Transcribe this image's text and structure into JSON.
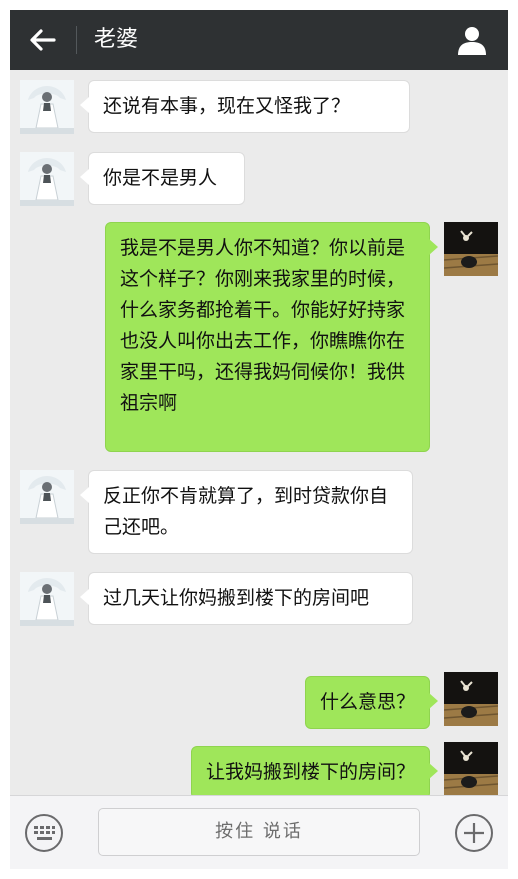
{
  "header": {
    "title": "老婆",
    "back_icon": "arrow-left-icon",
    "profile_icon": "person-icon"
  },
  "messages": [
    {
      "side": "left",
      "text": "还说有本事，现在又怪我了？"
    },
    {
      "side": "left",
      "text": "你是不是男人"
    },
    {
      "side": "right",
      "text": "我是不是男人你不知道？你以前是这个样子？你刚来我家里的时候，什么家务都抢着干。你能好好持家也没人叫你出去工作，你瞧瞧你在家里干吗，还得我妈伺候你！我供祖宗啊"
    },
    {
      "side": "left",
      "text": "反正你不肯就算了，到时贷款你自己还吧。"
    },
    {
      "side": "left",
      "text": "过几天让你妈搬到楼下的房间吧"
    },
    {
      "side": "right",
      "text": "什么意思？"
    },
    {
      "side": "right",
      "text": "让我妈搬到楼下的房间？"
    }
  ],
  "footer": {
    "voice_label": "按住 说话",
    "keyboard_icon": "keyboard-icon",
    "plus_icon": "plus-circle-icon"
  },
  "colors": {
    "header_bg": "#2e3133",
    "chat_bg": "#ebebeb",
    "sent_bubble": "#9fe65a",
    "received_bubble": "#ffffff"
  }
}
